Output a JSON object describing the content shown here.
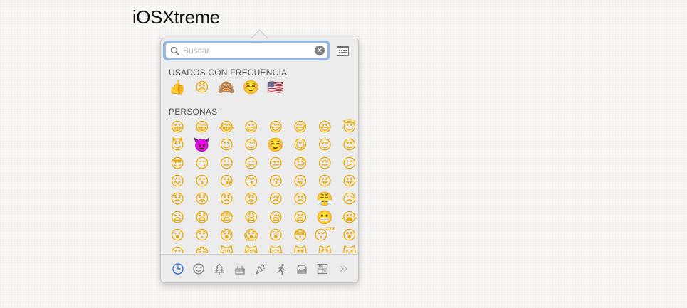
{
  "page": {
    "title": "iOSXtreme"
  },
  "search": {
    "placeholder": "Buscar",
    "value": ""
  },
  "sections": {
    "frequent": {
      "label": "USADOS CON FRECUENCIA",
      "emojis": [
        "👍",
        "😡",
        "🙈",
        "☺️",
        "🇺🇸"
      ]
    },
    "people": {
      "label": "PERSONAS",
      "rows": [
        [
          "😀",
          "😁",
          "😂",
          "😃",
          "😄",
          "😅",
          "😆",
          "😇"
        ],
        [
          "😈",
          "👿",
          "😉",
          "😊",
          "☺️",
          "😋",
          "😌",
          "😍"
        ],
        [
          "😎",
          "😏",
          "😐",
          "😑",
          "😒",
          "😓",
          "😔",
          "😕"
        ],
        [
          "😖",
          "😗",
          "😘",
          "😙",
          "😚",
          "😛",
          "😜",
          "😝"
        ],
        [
          "😞",
          "😟",
          "😠",
          "😡",
          "😢",
          "😣",
          "😤",
          "😥"
        ],
        [
          "😦",
          "😧",
          "😨",
          "😩",
          "😪",
          "😫",
          "😬",
          "😭"
        ],
        [
          "😮",
          "😯",
          "😰",
          "😱",
          "😲",
          "😳",
          "😴",
          "😵"
        ],
        [
          "😶",
          "😷",
          "😸",
          "😹",
          "😺",
          "😻",
          "😼",
          "😽"
        ]
      ]
    }
  },
  "categories": [
    {
      "icon": "clock-icon",
      "name": "Recientes",
      "selected": true
    },
    {
      "icon": "smiley-icon",
      "name": "Personas"
    },
    {
      "icon": "tree-icon",
      "name": "Naturaleza"
    },
    {
      "icon": "cake-icon",
      "name": "Comida"
    },
    {
      "icon": "party-popper-icon",
      "name": "Celebración"
    },
    {
      "icon": "runner-icon",
      "name": "Actividad"
    },
    {
      "icon": "car-icon",
      "name": "Viajes"
    },
    {
      "icon": "symbols-icon",
      "name": "Símbolos"
    },
    {
      "icon": "more-icon",
      "name": "Más"
    }
  ],
  "colors": {
    "selected_icon": "#2a6fd6",
    "icon": "#808080",
    "focus_ring": "#8fb7ea"
  }
}
